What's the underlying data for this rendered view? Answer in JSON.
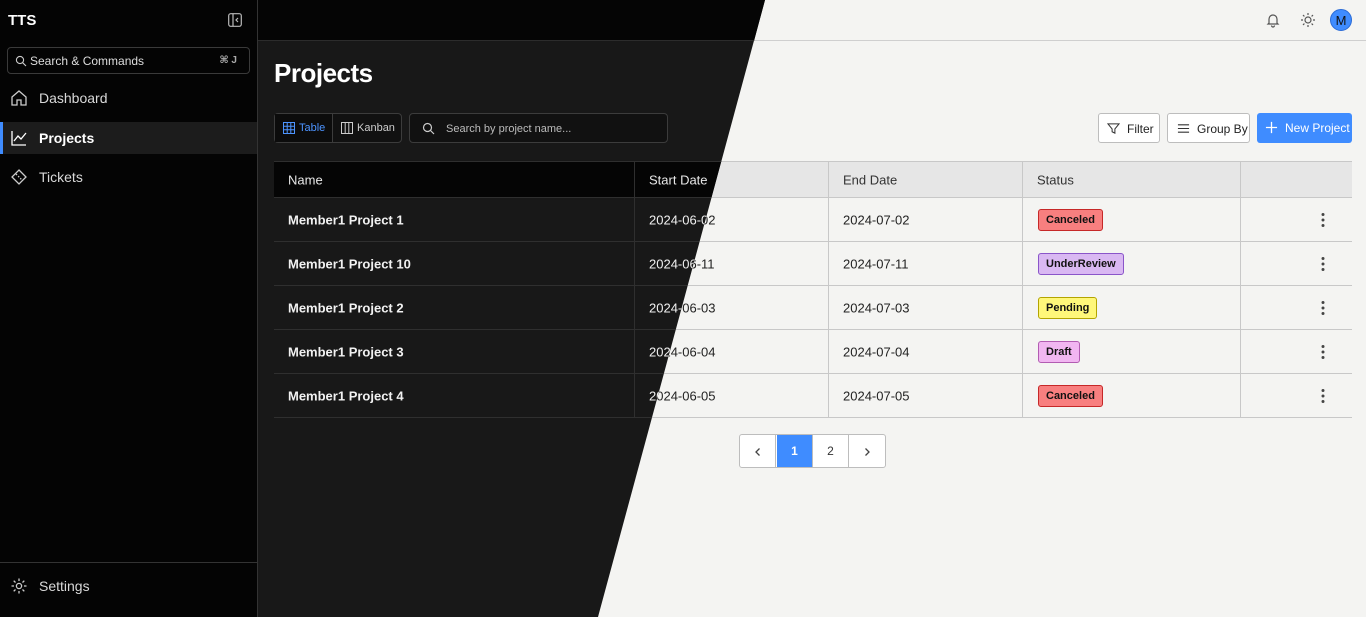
{
  "app": {
    "brand": "TTS"
  },
  "sidebar": {
    "search": {
      "label": "Search & Commands",
      "shortcut": "⌘ J"
    },
    "items": [
      {
        "label": "Dashboard",
        "icon": "home-icon",
        "active": false
      },
      {
        "label": "Projects",
        "icon": "chart-line-icon",
        "active": true
      },
      {
        "label": "Tickets",
        "icon": "ticket-icon",
        "active": false
      }
    ],
    "settings_label": "Settings"
  },
  "topbar": {
    "avatar_initial": "M"
  },
  "page": {
    "title": "Projects"
  },
  "toolbar": {
    "view_table": "Table",
    "view_kanban": "Kanban",
    "search_placeholder": "Search by project name...",
    "filter": "Filter",
    "group_by": "Group By",
    "new_project": "New Project"
  },
  "table": {
    "headers": {
      "name": "Name",
      "start": "Start Date",
      "end": "End Date",
      "status": "Status"
    },
    "rows": [
      {
        "name": "Member1 Project 1",
        "start": "2024-06-02",
        "end": "2024-07-02",
        "status": "Canceled"
      },
      {
        "name": "Member1 Project 10",
        "start": "2024-06-11",
        "end": "2024-07-11",
        "status": "UnderReview"
      },
      {
        "name": "Member1 Project 2",
        "start": "2024-06-03",
        "end": "2024-07-03",
        "status": "Pending"
      },
      {
        "name": "Member1 Project 3",
        "start": "2024-06-04",
        "end": "2024-07-04",
        "status": "Draft"
      },
      {
        "name": "Member1 Project 4",
        "start": "2024-06-05",
        "end": "2024-07-05",
        "status": "Canceled"
      }
    ]
  },
  "status_colors": {
    "Canceled": {
      "bg": "#f87f7f",
      "border": "#c62828"
    },
    "UnderReview": {
      "bg": "#d9b8f2",
      "border": "#8a55c9"
    },
    "Pending": {
      "bg": "#fff77a",
      "border": "#b3a400"
    },
    "Draft": {
      "bg": "#f1b6f1",
      "border": "#b25cb2"
    }
  },
  "pagination": {
    "pages": [
      "1",
      "2"
    ],
    "current": "1"
  },
  "colors": {
    "accent": "#3f8cff"
  }
}
